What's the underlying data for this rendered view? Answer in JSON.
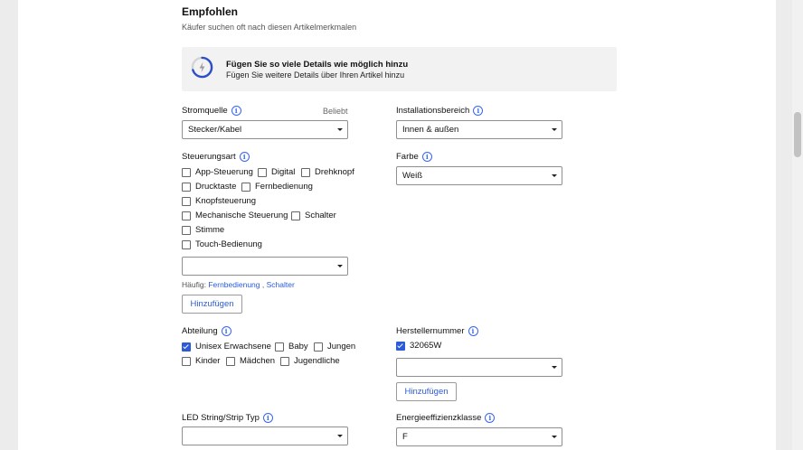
{
  "section": {
    "title": "Empfohlen",
    "subtitle": "Käufer suchen oft nach diesen Artikelmerkmalen"
  },
  "banner": {
    "title": "Fügen Sie so viele Details wie möglich hinzu",
    "subtitle": "Fügen Sie weitere Details über Ihren Artikel hinzu",
    "progress": 0.7
  },
  "stromquelle": {
    "label": "Stromquelle",
    "hint": "Beliebt",
    "value": "Stecker/Kabel"
  },
  "installationsbereich": {
    "label": "Installationsbereich",
    "value": "Innen & außen"
  },
  "steuerungsart": {
    "label": "Steuerungsart",
    "options": [
      {
        "label": "App-Steuerung",
        "checked": false
      },
      {
        "label": "Digital",
        "checked": false
      },
      {
        "label": "Drehknopf",
        "checked": false
      },
      {
        "label": "Drucktaste",
        "checked": false
      },
      {
        "label": "Fernbedienung",
        "checked": false
      },
      {
        "label": "Knopfsteuerung",
        "checked": false
      },
      {
        "label": "Mechanische Steuerung",
        "checked": false
      },
      {
        "label": "Schalter",
        "checked": false
      },
      {
        "label": "Stimme",
        "checked": false
      },
      {
        "label": "Touch-Bedienung",
        "checked": false
      }
    ],
    "select_value": "",
    "frequent_label": "Häufig:",
    "frequent_1": "Fernbedienung",
    "frequent_sep": ",",
    "frequent_2": "Schalter",
    "add_button": "Hinzufügen"
  },
  "farbe": {
    "label": "Farbe",
    "value": "Weiß"
  },
  "abteilung": {
    "label": "Abteilung",
    "options": [
      {
        "label": "Unisex Erwachsene",
        "checked": true
      },
      {
        "label": "Baby",
        "checked": false
      },
      {
        "label": "Jungen",
        "checked": false
      },
      {
        "label": "Kinder",
        "checked": false
      },
      {
        "label": "Mädchen",
        "checked": false
      },
      {
        "label": "Jugendliche",
        "checked": false
      }
    ]
  },
  "herstellernummer": {
    "label": "Herstellernummer",
    "checked_value": "32065W",
    "select_value": "",
    "add_button": "Hinzufügen"
  },
  "led_typ": {
    "label": "LED String/Strip Typ",
    "value": ""
  },
  "energieeffizienz": {
    "label": "Energieeffizienzklasse",
    "value": "F"
  },
  "colors": {
    "accent": "#3665f3",
    "checkbox": "#2c5bd8",
    "banner_bg": "#f2f2f2"
  }
}
